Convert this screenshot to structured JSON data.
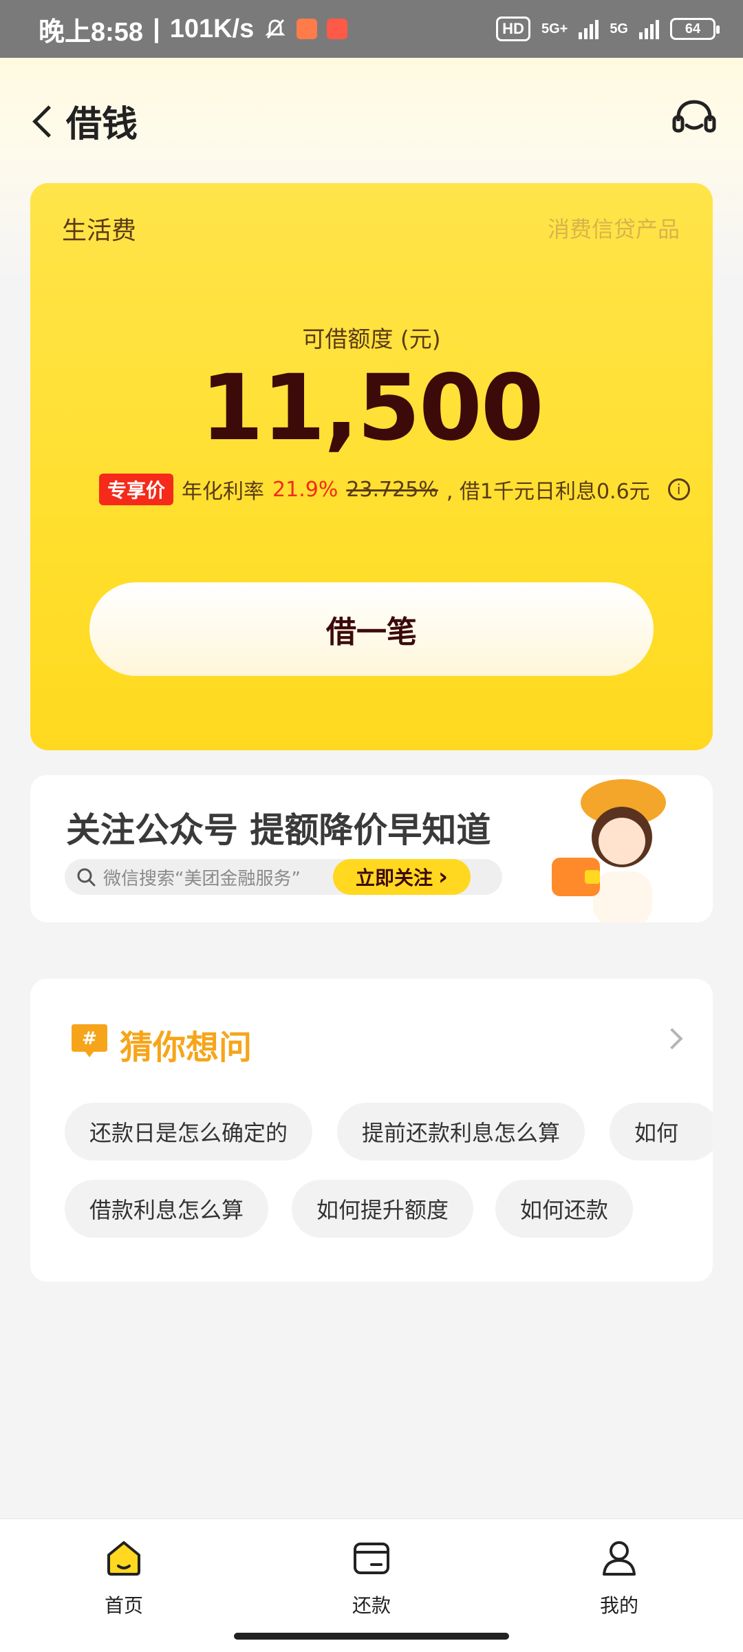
{
  "status_bar": {
    "time": "晚上8:58",
    "speed": "101K/s",
    "hd": "HD",
    "net1": "5G+",
    "net2": "5G",
    "battery": "64"
  },
  "header": {
    "title": "借钱"
  },
  "card": {
    "label": "生活费",
    "tag": "消费信贷产品",
    "limit_label": "可借额度 (元)",
    "limit_value": "11,500",
    "exclusive_badge": "专享价",
    "rate_label": "年化利率",
    "rate_new": "21.9%",
    "rate_old": "23.725%",
    "rate_note": ", 借1千元日利息0.6元",
    "borrow_button": "借一笔"
  },
  "banner": {
    "title": "关注公众号 提额降价早知道",
    "search_text": "微信搜索“美团金融服务”",
    "follow_button": "立即关注"
  },
  "faq": {
    "title": "猜你想问",
    "chips": [
      "还款日是怎么确定的",
      "提前还款利息怎么算",
      "如何",
      "借款利息怎么算",
      "如何提升额度",
      "如何还款"
    ]
  },
  "nav": {
    "items": [
      {
        "label": "首页"
      },
      {
        "label": "还款"
      },
      {
        "label": "我的"
      }
    ]
  },
  "colors": {
    "brand_yellow": "#ffd91f",
    "accent_red": "#f52a1a",
    "faq_orange": "#f6a51a"
  }
}
